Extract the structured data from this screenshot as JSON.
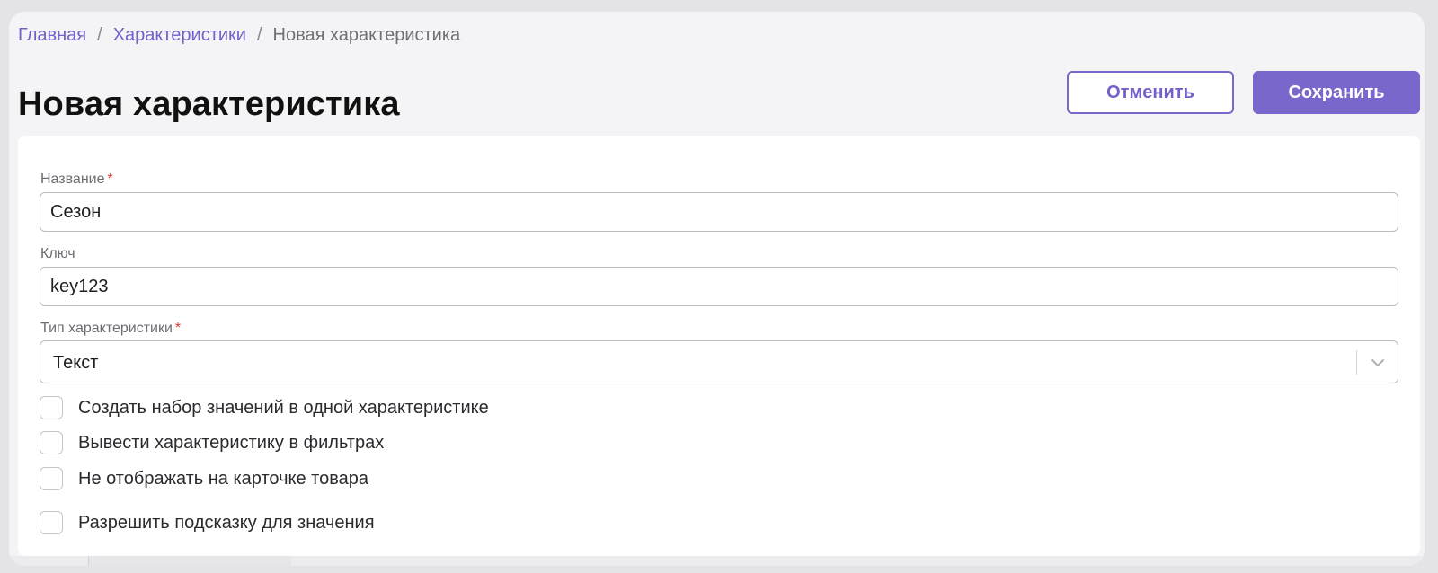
{
  "breadcrumb": {
    "home": "Главная",
    "separator": "/",
    "section": "Характеристики",
    "current": "Новая характеристика"
  },
  "header": {
    "title": "Новая характеристика",
    "cancel_label": "Отменить",
    "save_label": "Сохранить"
  },
  "form": {
    "required_mark": "*",
    "name": {
      "label": "Название",
      "value": "Сезон"
    },
    "key": {
      "label": "Ключ",
      "value": "key123"
    },
    "type": {
      "label": "Тип характеристики",
      "value": "Текст"
    },
    "checkboxes": [
      {
        "label": "Создать набор значений в одной характеристике",
        "checked": false
      },
      {
        "label": "Вывести характеристику в фильтрах",
        "checked": false
      },
      {
        "label": "Не отображать на карточке товара",
        "checked": false
      },
      {
        "label": "Разрешить подсказку для значения",
        "checked": false
      }
    ]
  },
  "colors": {
    "accent": "#7B66CC",
    "required": "#D93A3A",
    "background": "#F4F4F6"
  },
  "icons": {
    "select_arrow": "chevron-down-icon"
  }
}
